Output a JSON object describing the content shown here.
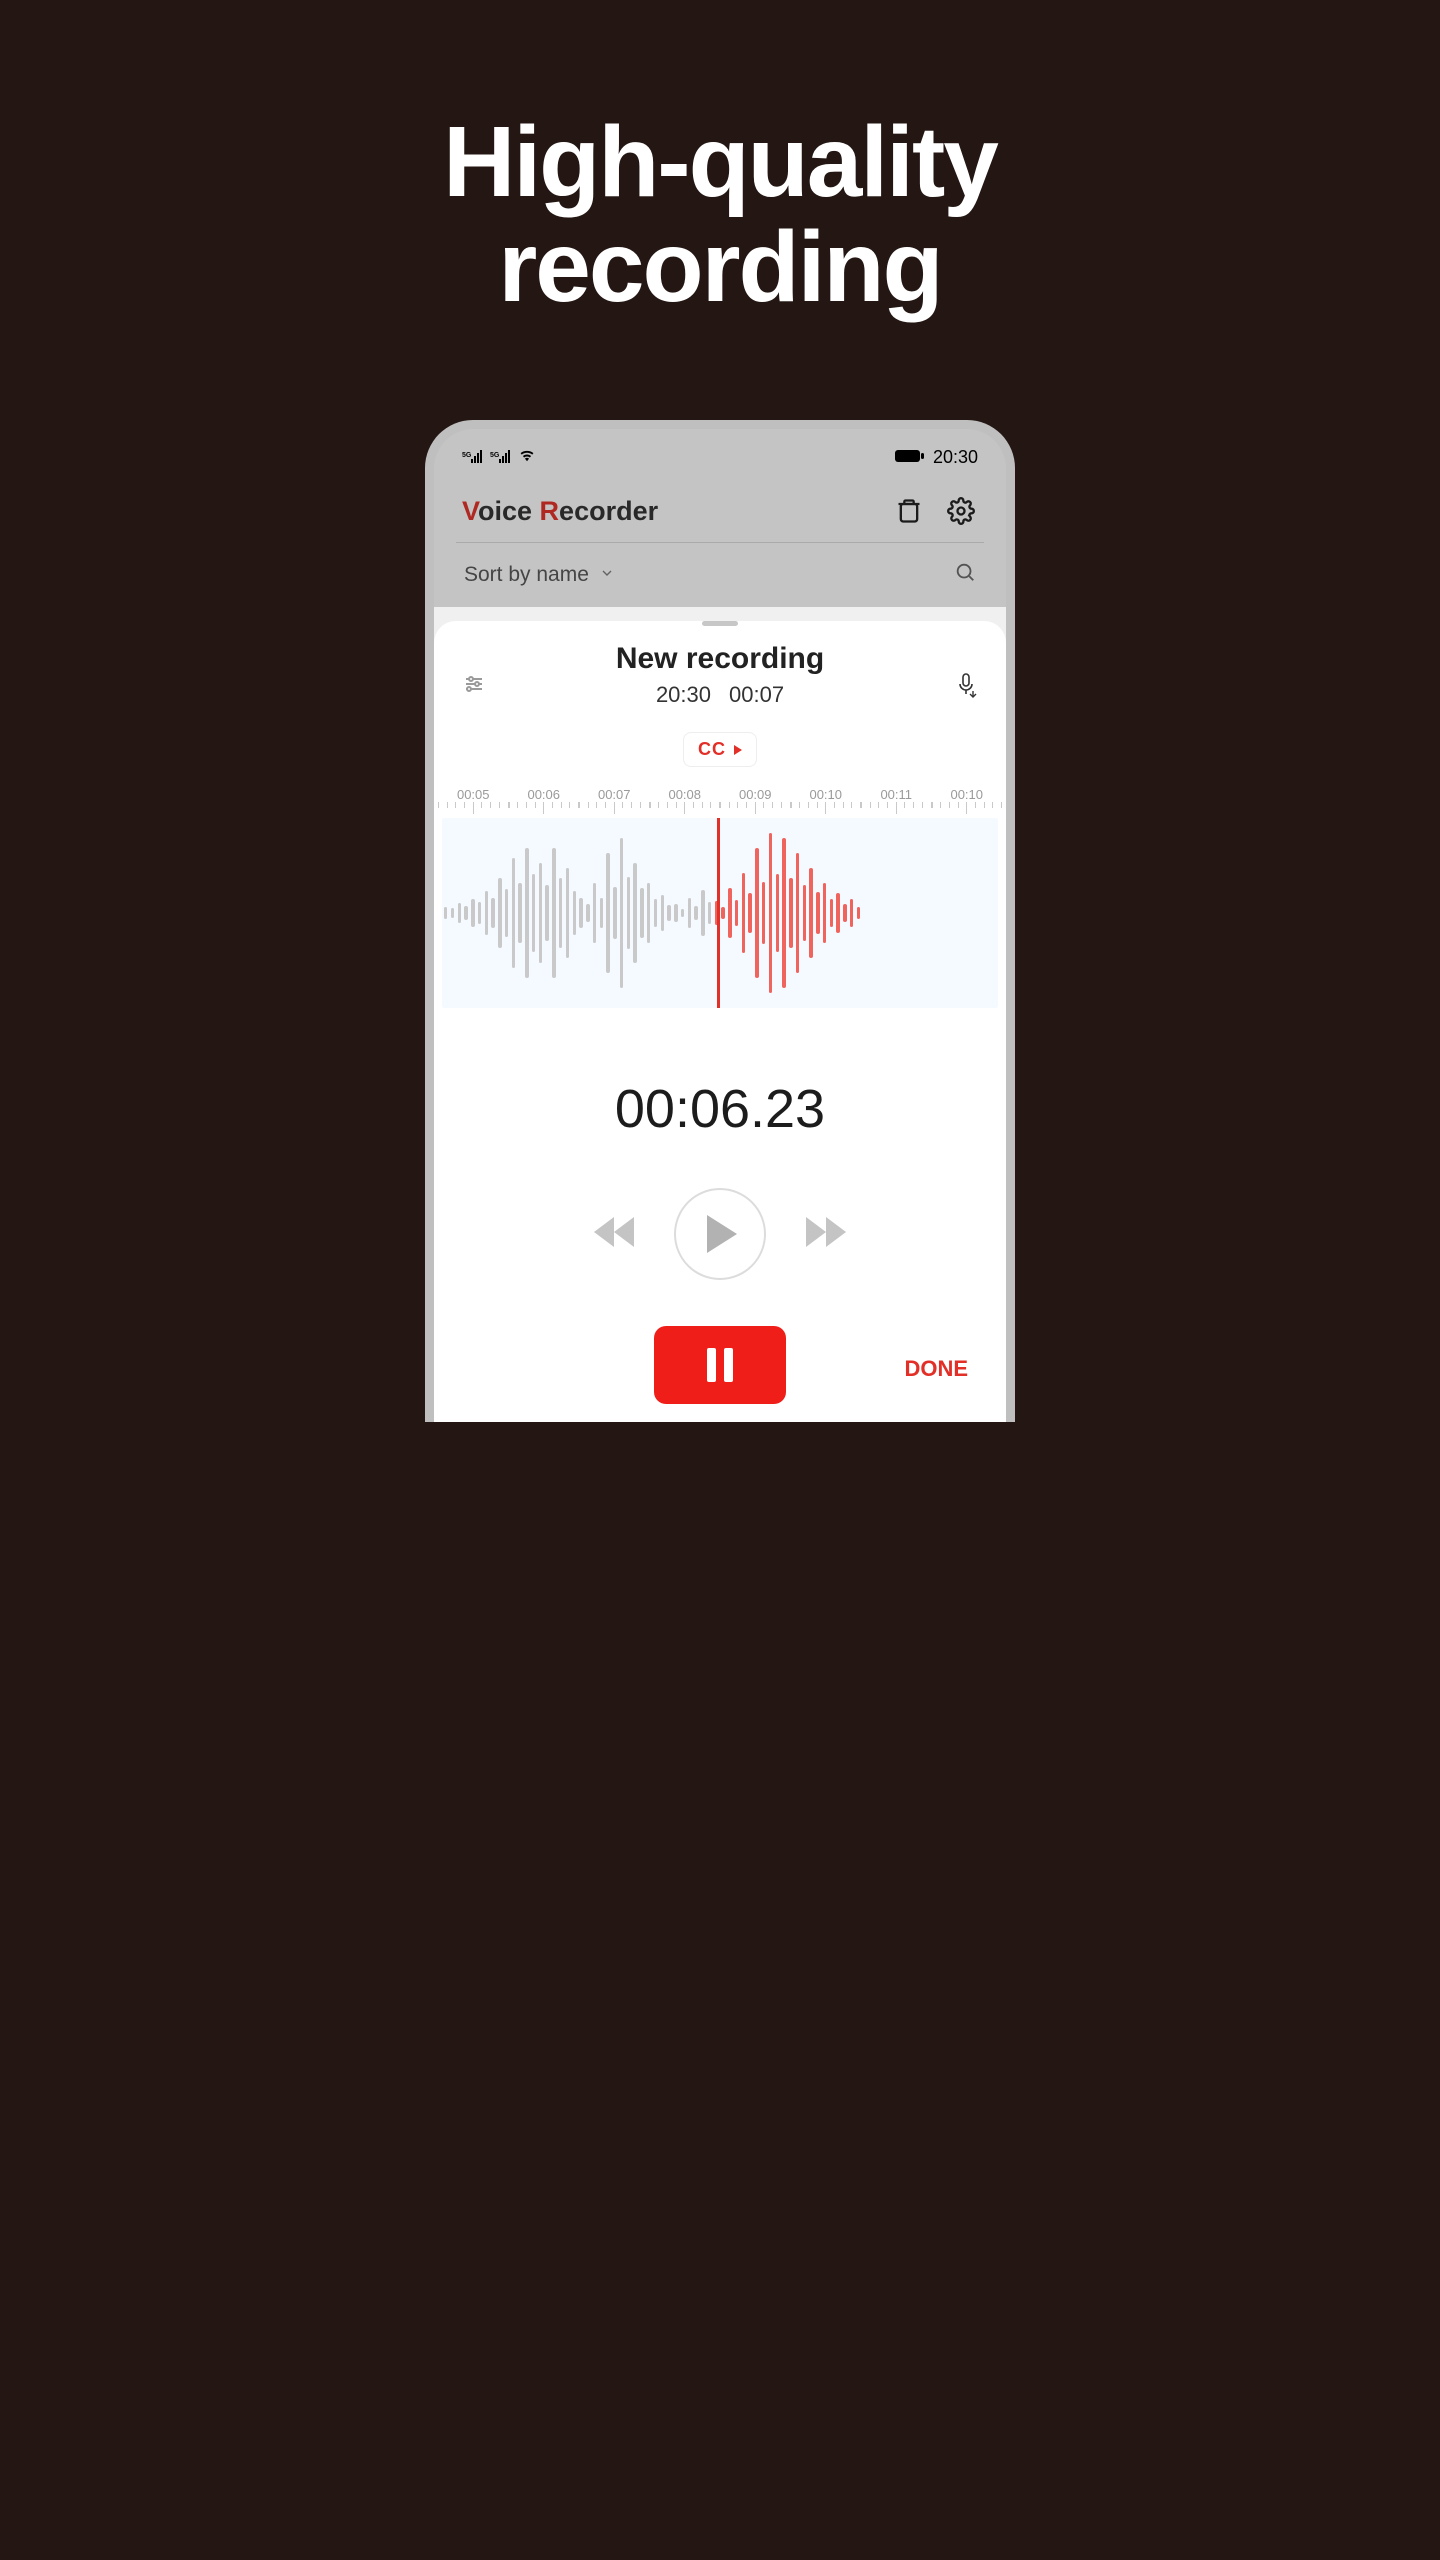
{
  "promo": {
    "line1": "High-quality",
    "line2": "recording"
  },
  "statusbar": {
    "time": "20:30"
  },
  "app": {
    "title_v": "V",
    "title_oice": "oice ",
    "title_r": "R",
    "title_ecorder": "ecorder"
  },
  "sortbar": {
    "label": "Sort by name"
  },
  "sheet": {
    "title": "New recording",
    "time": "20:30",
    "duration": "00:07",
    "cc": "CC",
    "timeline": [
      "00:05",
      "00:06",
      "00:07",
      "00:08",
      "00:09",
      "00:10",
      "00:11",
      "00:10"
    ],
    "bigtimer": "00:06.23",
    "done": "DONE"
  },
  "waveform": {
    "grey": [
      12,
      10,
      20,
      14,
      28,
      22,
      44,
      30,
      70,
      48,
      110,
      60,
      130,
      78,
      100,
      56,
      130,
      70,
      90,
      44,
      30,
      18,
      60,
      30,
      120,
      52,
      150,
      72,
      100,
      50,
      60,
      28,
      36,
      16,
      18,
      8,
      30,
      14,
      46,
      22
    ],
    "red": [
      24,
      12,
      50,
      26,
      80,
      40,
      130,
      62,
      160,
      78,
      150,
      70,
      120,
      56,
      90,
      42,
      60,
      28,
      40,
      18,
      28,
      12
    ]
  }
}
